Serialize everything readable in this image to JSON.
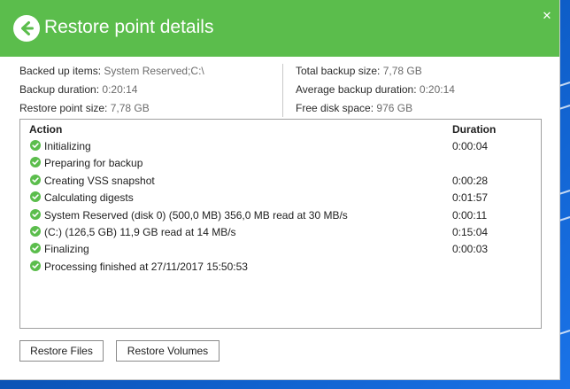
{
  "header": {
    "title": "Restore point details",
    "back_icon": "arrow-left-circle-icon",
    "close_label": "✕",
    "color": "#5bbd4c"
  },
  "info": {
    "left": [
      {
        "label": "Backed up items:",
        "value": "System Reserved;C:\\"
      },
      {
        "label": "Backup duration:",
        "value": "0:20:14"
      },
      {
        "label": "Restore point size:",
        "value": "7,78 GB"
      }
    ],
    "right": [
      {
        "label": "Total backup size:",
        "value": "7,78 GB"
      },
      {
        "label": "Average backup duration:",
        "value": "0:20:14"
      },
      {
        "label": "Free disk space:",
        "value": "976 GB"
      }
    ]
  },
  "log": {
    "columns": {
      "action": "Action",
      "duration": "Duration"
    },
    "check_icon": "check-circle-icon",
    "check_color": "#5bbd4c",
    "rows": [
      {
        "action": "Initializing",
        "duration": "0:00:04"
      },
      {
        "action": "Preparing for backup",
        "duration": ""
      },
      {
        "action": "Creating VSS snapshot",
        "duration": "0:00:28"
      },
      {
        "action": "Calculating digests",
        "duration": "0:01:57"
      },
      {
        "action": "System Reserved (disk 0) (500,0 MB) 356,0 MB read at 30 MB/s",
        "duration": "0:00:11"
      },
      {
        "action": " (C:) (126,5 GB) 11,9 GB read at 14 MB/s",
        "duration": "0:15:04"
      },
      {
        "action": "Finalizing",
        "duration": "0:00:03"
      },
      {
        "action": "Processing finished at 27/11/2017 15:50:53",
        "duration": ""
      }
    ]
  },
  "buttons": {
    "restore_files": "Restore Files",
    "restore_volumes": "Restore Volumes"
  }
}
